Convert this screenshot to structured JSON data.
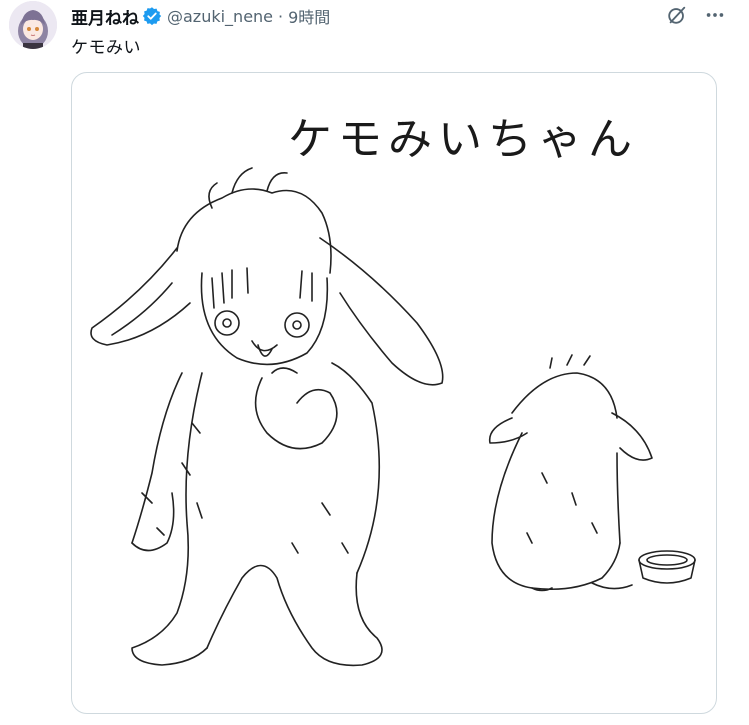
{
  "tweet": {
    "display_name": "亜月ねね",
    "handle": "@azuki_nene",
    "separator": "·",
    "time": "9時間",
    "text": "ケモみい"
  },
  "media": {
    "caption": "ケモみいちゃん"
  },
  "colors": {
    "verified": "#1d9bf0",
    "secondary_text": "#536471",
    "border": "#cfd9de"
  },
  "icons": {
    "verified": "verified-badge-icon",
    "grok": "grok-icon",
    "more": "more-icon"
  }
}
